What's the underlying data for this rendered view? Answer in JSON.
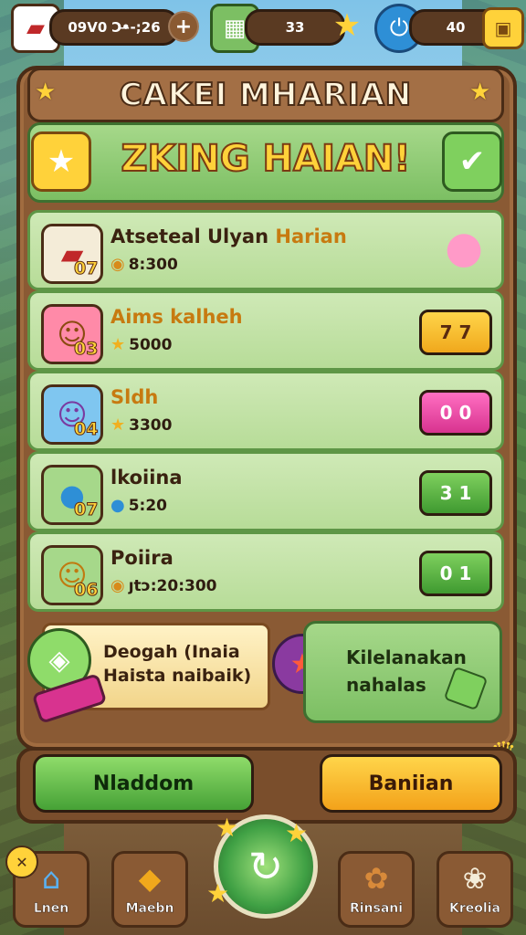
{
  "topbar": {
    "currency_value": "09V0 Ͻ•̶-;26",
    "plus_label": "+",
    "gems_value": "33",
    "energy_value": "40"
  },
  "header": {
    "title": "CAKEI MHARIAN",
    "banner": "ZKING HAIAN!"
  },
  "quests": [
    {
      "num": "07",
      "title": "Atseteal Ulyan ",
      "title_hl": "Harian",
      "reward": "8:300",
      "icon": "book-icon",
      "action": ""
    },
    {
      "num": "03",
      "title": "Aims kalheh",
      "title_hl": "",
      "reward": "5000",
      "icon": "character-icon",
      "action": "7 7"
    },
    {
      "num": "04",
      "title": "Sldh",
      "title_hl": "",
      "reward": "3300",
      "icon": "character-icon",
      "action": "0 0"
    },
    {
      "num": "07",
      "title": "lkoiina",
      "title_hl": "",
      "reward": "5:20",
      "icon": "orb-icon",
      "action": "3 1"
    },
    {
      "num": "06",
      "title": "Poiira",
      "title_hl": "",
      "reward": "ȷtͻ:20:300",
      "icon": "character-icon",
      "action": "0 1"
    }
  ],
  "bottom": {
    "scroll_text_1": "Deogah (Inaia",
    "scroll_text_2": "Haista naibaik)",
    "panel_text_1": "Kilelanakan",
    "panel_text_2": "nahalas"
  },
  "actions": {
    "left_label": "Nladdom",
    "right_label": "Baniian"
  },
  "nav": [
    {
      "label": "Lnen",
      "icon": "house-icon"
    },
    {
      "label": "Maebn",
      "icon": "map-icon"
    },
    {
      "label": "Rinsani",
      "icon": "cookie-icon"
    },
    {
      "label": "Kreolia",
      "icon": "flower-icon"
    }
  ],
  "colors": {
    "wood": "#8a5a34",
    "leaf": "#7cbf63",
    "gold": "#ffd23a",
    "pink": "#d8338f"
  }
}
